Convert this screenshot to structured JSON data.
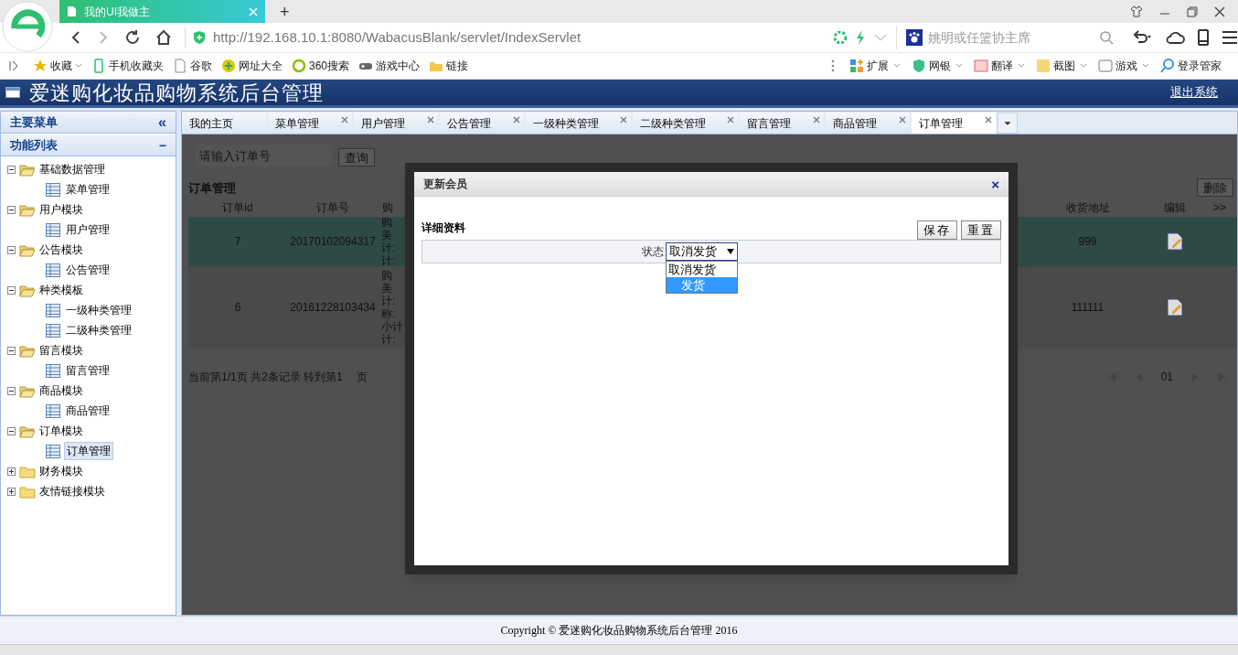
{
  "browser": {
    "tab_title": "我的UI我做主",
    "new_tab": "+",
    "url": "http://192.168.10.1:8080/WabacusBlank/servlet/IndexServlet",
    "search_placeholder": "姚明或任篮协主席",
    "bookmarks_left": [
      {
        "label": "收藏",
        "menu": true
      },
      {
        "label": "手机收藏夹",
        "menu": false
      },
      {
        "label": "谷歌",
        "menu": false
      },
      {
        "label": "网址大全",
        "menu": false
      },
      {
        "label": "360搜索",
        "menu": false
      },
      {
        "label": "游戏中心",
        "menu": false
      },
      {
        "label": "链接",
        "menu": false
      }
    ],
    "bookmarks_right": [
      {
        "label": "扩展",
        "menu": true
      },
      {
        "label": "网银",
        "menu": true
      },
      {
        "label": "翻译",
        "menu": true
      },
      {
        "label": "截图",
        "menu": true
      },
      {
        "label": "游戏",
        "menu": true
      },
      {
        "label": "登录管家",
        "menu": false
      }
    ]
  },
  "app": {
    "title": "爱迷购化妆品购物系统后台管理",
    "logout": "退出系统"
  },
  "sidebar": {
    "header": "主要菜单",
    "collapse": "«",
    "section": "功能列表",
    "section_toggle": "−",
    "tree": [
      {
        "label": "基础数据管理",
        "expanded": true,
        "children": [
          {
            "label": "菜单管理",
            "selected": false
          }
        ]
      },
      {
        "label": "用户模块",
        "expanded": true,
        "children": [
          {
            "label": "用户管理",
            "selected": false
          }
        ]
      },
      {
        "label": "公告模块",
        "expanded": true,
        "children": [
          {
            "label": "公告管理",
            "selected": false
          }
        ]
      },
      {
        "label": "种类模板",
        "expanded": true,
        "children": [
          {
            "label": "一级种类管理",
            "selected": false
          },
          {
            "label": "二级种类管理",
            "selected": false
          }
        ]
      },
      {
        "label": "留言模块",
        "expanded": true,
        "children": [
          {
            "label": "留言管理",
            "selected": false
          }
        ]
      },
      {
        "label": "商品模块",
        "expanded": true,
        "children": [
          {
            "label": "商品管理",
            "selected": false
          }
        ]
      },
      {
        "label": "订单模块",
        "expanded": true,
        "children": [
          {
            "label": "订单管理",
            "selected": true
          }
        ]
      },
      {
        "label": "财务模块",
        "expanded": false
      },
      {
        "label": "友情链接模块",
        "expanded": false
      }
    ]
  },
  "tabs": [
    {
      "label": "我的主页",
      "closable": false,
      "selected": false
    },
    {
      "label": "菜单管理",
      "closable": true,
      "selected": false
    },
    {
      "label": "用户管理",
      "closable": true,
      "selected": false
    },
    {
      "label": "公告管理",
      "closable": true,
      "selected": false
    },
    {
      "label": "一级种类管理",
      "closable": true,
      "selected": false
    },
    {
      "label": "二级种类管理",
      "closable": true,
      "selected": false
    },
    {
      "label": "留言管理",
      "closable": true,
      "selected": false
    },
    {
      "label": "商品管理",
      "closable": true,
      "selected": false
    },
    {
      "label": "订单管理",
      "closable": true,
      "selected": true
    }
  ],
  "orders": {
    "search_placeholder": "请输入订单号",
    "search_button": "查询",
    "title": "订单管理",
    "delete_button": "删除",
    "columns": {
      "id": "订单id",
      "number": "订单号",
      "column_3": "购",
      "address": "收货地址",
      "edit": "编辑",
      "more": ">>"
    },
    "rows": [
      {
        "selected": true,
        "id": "7",
        "number": "20170102094317",
        "column_3": [
          "购",
          "美",
          "计:",
          "计:"
        ],
        "address": "999"
      },
      {
        "selected": false,
        "id": "6",
        "number": "20161228103434",
        "column_3": [
          "购",
          "美",
          "计:",
          "称:",
          "小计",
          "计:"
        ],
        "address": "111111"
      }
    ],
    "pagination": {
      "text": "当前第1/1页 共2条记录 转到第",
      "page_input": "1",
      "page_suffix": "页",
      "current": "01"
    }
  },
  "dialog": {
    "title": "更新会员",
    "close": "×",
    "section": "详细资料",
    "buttons": [
      "保存",
      "重置"
    ],
    "field": {
      "label": "状态",
      "value": "取消发货",
      "options": [
        {
          "label": "取消发货",
          "highlighted": false
        },
        {
          "label": "发货",
          "highlighted": true
        }
      ]
    }
  },
  "footer": "Copyright © 爱迷购化妆品购物系统后台管理 2016"
}
